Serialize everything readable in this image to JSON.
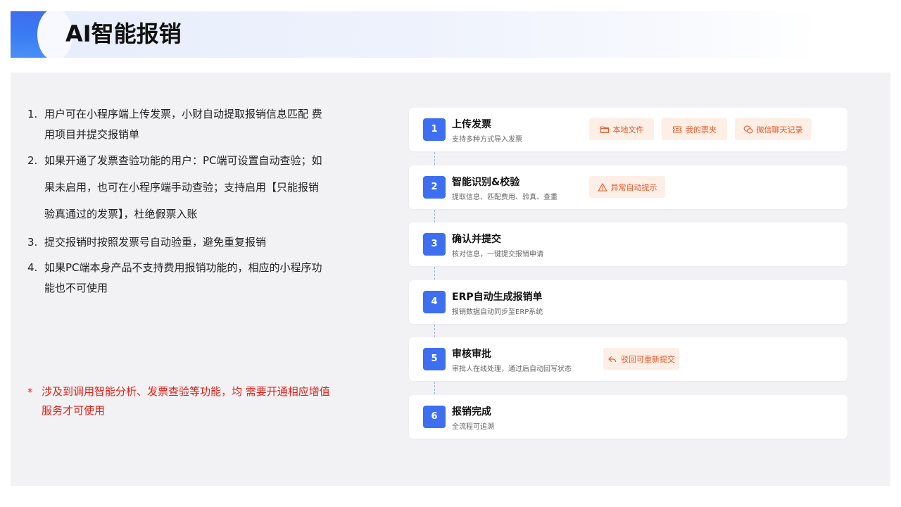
{
  "header": {
    "title": "AI智能报销"
  },
  "left_list": [
    {
      "num": "1.",
      "lines": [
        "用户可在小程序端上传发票，小财自动提取报销信息匹配  费",
        "用项目并提交报销单"
      ]
    },
    {
      "num": "2.",
      "lines": [
        "如果开通了发票查验功能的用户：PC端可设置自动查验；如",
        "果未启用，也可在小程序端手动查验；支持启用【只能报销",
        "验真通过的发票】，杜绝假票入账"
      ]
    },
    {
      "num": "3.",
      "lines": [
        "提交报销时按照发票号自动验重，避免重复报销"
      ]
    },
    {
      "num": "4.",
      "lines": [
        "如果PC端本身产品不支持费用报销功能的，相应的小程序功",
        "能也不可使用"
      ]
    }
  ],
  "note": {
    "star": "*",
    "lines": [
      "涉及到调用智能分析、发票查验等功能，均 需要开通相应增值",
      "服务才可使用"
    ]
  },
  "steps": [
    {
      "num": "1",
      "title": "上传发票",
      "desc": "支持多种方式导入发票",
      "chips": [
        {
          "label": "本地文件",
          "icon": "folder-icon"
        },
        {
          "label": "我的票夹",
          "icon": "ticket-icon"
        },
        {
          "label": "微信聊天记录",
          "icon": "wechat-icon"
        }
      ]
    },
    {
      "num": "2",
      "title": "智能识别&校验",
      "desc": "提取信息、匹配费用、验真、查重",
      "chips": [
        {
          "label": "异常自动提示",
          "icon": "warning-icon"
        }
      ]
    },
    {
      "num": "3",
      "title": "确认并提交",
      "desc": "核对信息，一键提交报销申请",
      "chips": []
    },
    {
      "num": "4",
      "title": "ERP自动生成报销单",
      "desc": "报销数据自动同步至ERP系统",
      "chips": []
    },
    {
      "num": "5",
      "title": "审核审批",
      "desc": "审批人在线处理，通过后自动回写状态",
      "chips": [
        {
          "label": "驳回可重新提交",
          "icon": "reply-icon"
        }
      ]
    },
    {
      "num": "6",
      "title": "报销完成",
      "desc": "全流程可追溯",
      "chips": []
    }
  ],
  "colors": {
    "accent": "#3d6ff0",
    "chip_bg": "#fdeee6",
    "chip_text": "#e5592a",
    "note": "#e0211a"
  }
}
